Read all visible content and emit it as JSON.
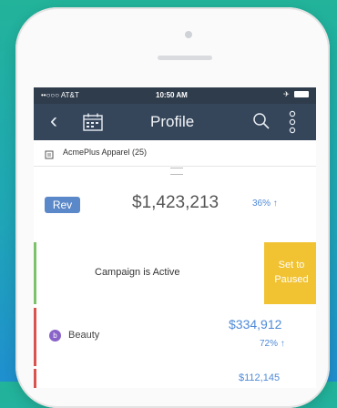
{
  "status_bar": {
    "carrier": "••○○○ AT&T",
    "time": "10:50 AM",
    "battery_prefix": "✈"
  },
  "nav": {
    "back": "‹",
    "title": "Profile"
  },
  "account": {
    "name": "AcmePlus Apparel (25)"
  },
  "revenue": {
    "badge": "Rev",
    "amount": "$1,423,213",
    "percent": "36% ↑"
  },
  "campaign": {
    "status": "Campaign is Active",
    "action": "Set to Paused"
  },
  "categories": [
    {
      "icon_letter": "b",
      "label": "Beauty",
      "amount": "$334,912",
      "percent": "72% ↑"
    },
    {
      "amount": "$112,145"
    }
  ],
  "colors": {
    "nav_bg": "#35455a",
    "accent_blue": "#4f8ad8",
    "badge_bg": "#5b88c9",
    "pause_yellow": "#f1c232",
    "active_green": "#7cc26a",
    "alert_red": "#d9534f"
  },
  "icons": [
    "back-icon",
    "calendar-icon",
    "search-icon",
    "more-vertical-icon",
    "document-icon",
    "beauty-category-icon"
  ]
}
